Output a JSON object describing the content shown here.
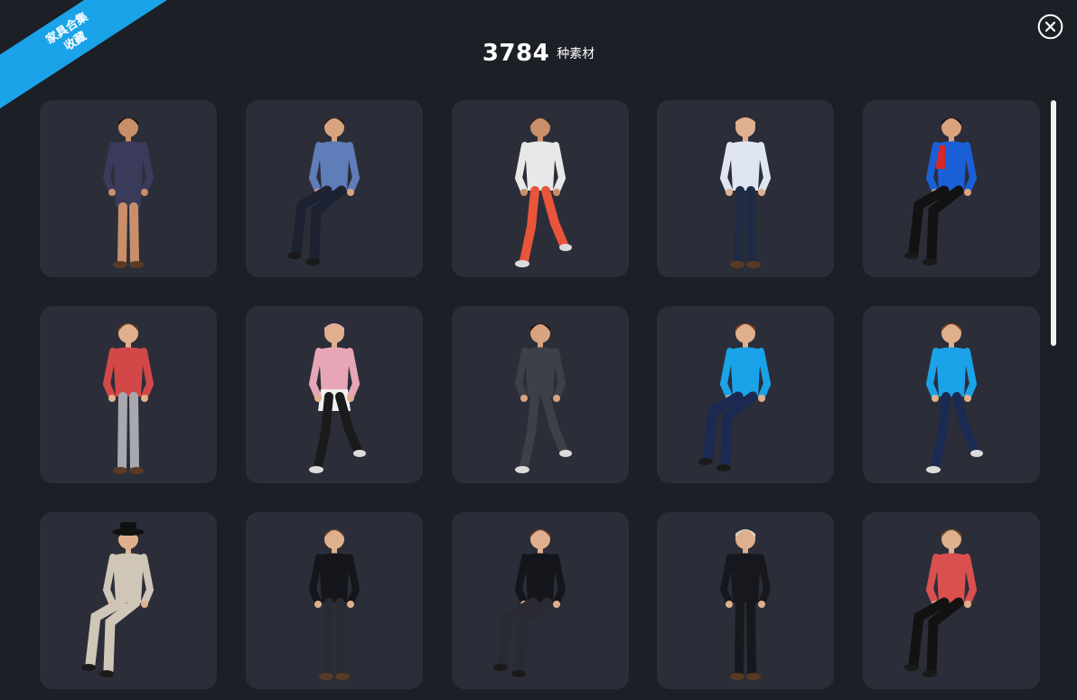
{
  "ribbon": {
    "line1": "家具合集",
    "line2": "收藏"
  },
  "header": {
    "count": "3784",
    "unit": "种素材"
  },
  "close_icon": "close-circle-icon",
  "colors": {
    "background": "#1c1f26",
    "card": "#2b2e38",
    "ribbon": "#1aa3e8",
    "text": "#ffffff"
  },
  "items": [
    {
      "name": "woman-floral-dress-standing"
    },
    {
      "name": "man-blue-blazer-sitting"
    },
    {
      "name": "woman-running-orange-shorts"
    },
    {
      "name": "bald-man-arms-crossed"
    },
    {
      "name": "man-windbreaker-sitting"
    },
    {
      "name": "boy-red-sweater-backpack"
    },
    {
      "name": "woman-pink-hijab-walking"
    },
    {
      "name": "man-grey-suit-walking"
    },
    {
      "name": "woman-blue-jacket-sitting"
    },
    {
      "name": "woman-blue-jacket-walking"
    },
    {
      "name": "woman-hat-trench-coat-sitting"
    },
    {
      "name": "woman-black-blazer-standing"
    },
    {
      "name": "woman-black-blazer-sitting"
    },
    {
      "name": "old-man-suit-standing"
    },
    {
      "name": "woman-red-sweater-sitting"
    }
  ]
}
